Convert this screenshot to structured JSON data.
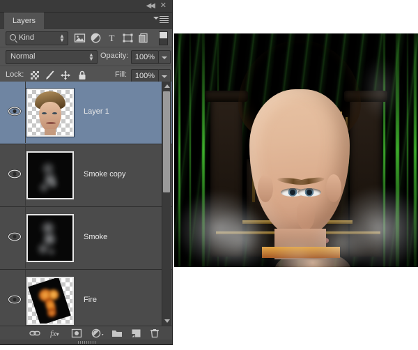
{
  "window": {
    "collapse_label": "◀◀",
    "close_label": "✕"
  },
  "panel": {
    "tab_label": "Layers",
    "menu_icon": "panel-menu-icon"
  },
  "filter": {
    "kind_label": "Kind",
    "search_icon": "search-icon",
    "icons": [
      {
        "name": "filter-pixel-icon",
        "title": "Pixel Layers"
      },
      {
        "name": "filter-adjustment-icon",
        "title": "Adjustment Layers"
      },
      {
        "name": "filter-type-icon",
        "title": "Type Layers",
        "glyph": "T"
      },
      {
        "name": "filter-shape-icon",
        "title": "Shape Layers"
      },
      {
        "name": "filter-smart-object-icon",
        "title": "Smart Objects"
      }
    ],
    "toggle_name": "filter-enable-toggle"
  },
  "blend": {
    "mode": "Normal",
    "opacity_label": "Opacity:",
    "opacity_value": "100%"
  },
  "lock": {
    "label": "Lock:",
    "icons": [
      {
        "name": "lock-transparent-pixels-icon"
      },
      {
        "name": "lock-image-pixels-icon"
      },
      {
        "name": "lock-position-icon"
      },
      {
        "name": "lock-all-icon"
      }
    ],
    "fill_label": "Fill:",
    "fill_value": "100%"
  },
  "layers": [
    {
      "name": "Layer 1",
      "selected": true,
      "visible": true,
      "thumb": "portrait"
    },
    {
      "name": "Smoke copy",
      "selected": false,
      "visible": true,
      "thumb": "smoke"
    },
    {
      "name": "Smoke",
      "selected": false,
      "visible": true,
      "thumb": "smoke"
    },
    {
      "name": "Fire",
      "selected": false,
      "visible": true,
      "thumb": "fire"
    }
  ],
  "bottom_toolbar": [
    {
      "name": "link-layers-icon"
    },
    {
      "name": "layer-styles-fx-icon",
      "glyph": "fx"
    },
    {
      "name": "add-layer-mask-icon"
    },
    {
      "name": "new-adjustment-layer-icon"
    },
    {
      "name": "new-group-icon"
    },
    {
      "name": "new-layer-icon"
    },
    {
      "name": "delete-layer-icon"
    }
  ],
  "colors": {
    "panel_bg": "#535353",
    "list_bg": "#4b4b4b",
    "selected_row": "#6f85a2",
    "text": "#dcdcdc",
    "title_bar": "#3a3a3a"
  },
  "canvas": {
    "description": "composited portrait on dark green background with smoke"
  }
}
